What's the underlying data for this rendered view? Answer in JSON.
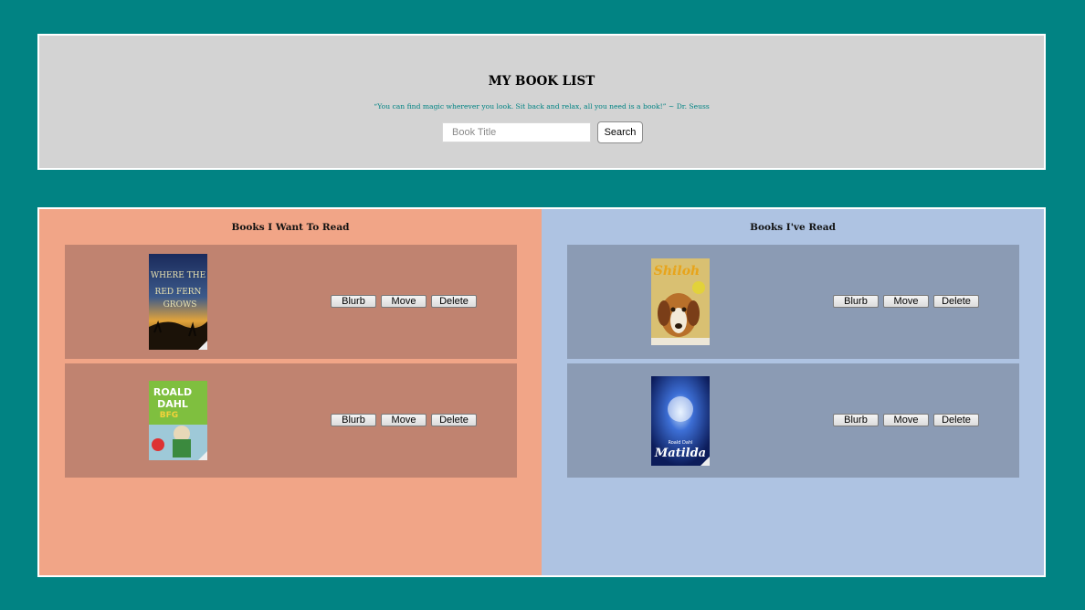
{
  "header": {
    "title": "MY BOOK LIST",
    "quote": "“You can find magic wherever you look. Sit back and relax, all you need is a book!” ~ Dr. Seuss",
    "search_placeholder": "Book Title",
    "search_label": "Search"
  },
  "want_to_read": {
    "title": "Books I Want To Read",
    "books": [
      {
        "cover_alt": "Where the Red Fern Grows",
        "blurb_label": "Blurb",
        "move_label": "Move",
        "delete_label": "Delete"
      },
      {
        "cover_alt": "Roald Dahl The BFG",
        "blurb_label": "Blurb",
        "move_label": "Move",
        "delete_label": "Delete"
      }
    ]
  },
  "have_read": {
    "title": "Books I've Read",
    "books": [
      {
        "cover_alt": "Shiloh",
        "blurb_label": "Blurb",
        "move_label": "Move",
        "delete_label": "Delete"
      },
      {
        "cover_alt": "Roald Dahl Matilda",
        "blurb_label": "Blurb",
        "move_label": "Move",
        "delete_label": "Delete"
      }
    ]
  },
  "colors": {
    "background": "#018383",
    "header_bg": "#d3d3d3",
    "want_panel": "#f1a587",
    "want_card": "#c08370",
    "read_panel": "#aec3e2",
    "read_card": "#8b9bb4"
  }
}
